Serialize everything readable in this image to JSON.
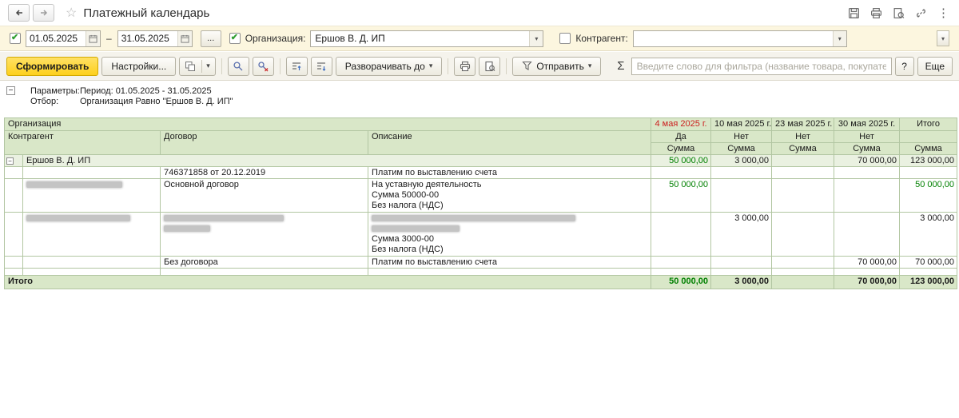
{
  "colors": {
    "accent_yellow": "#FDD01C",
    "header_green": "#D9E7C8",
    "group_green": "#EAF1E1",
    "amount_green": "#008000",
    "overdue_red": "#CC1F1F",
    "filter_bar_bg": "#FCF6DF"
  },
  "icons": {
    "back": "left-arrow",
    "forward": "right-arrow",
    "favorite": "star-outline",
    "save": "floppy",
    "print": "printer",
    "preview": "page-magnifier",
    "link": "chain",
    "menu": "kebab-dots",
    "calendar": "calendar-grid",
    "dropdown": "caret-down",
    "search": "magnifier",
    "cancel_search": "magnifier-x",
    "collapse_groups": "bars-arrow-up",
    "expand_groups": "bars-arrow-down",
    "send": "funnel",
    "variants": "layered-sheets"
  },
  "topbar": {
    "title": "Платежный календарь"
  },
  "filters": {
    "date_from": "01.05.2025",
    "range_dash": "–",
    "date_to": "31.05.2025",
    "period_more": "...",
    "org_label": "Организация:",
    "org_value": "Ершов В. Д. ИП",
    "contragent_label": "Контрагент:",
    "contragent_value": ""
  },
  "toolbar": {
    "generate": "Сформировать",
    "settings": "Настройки...",
    "expand_to": "Разворачивать до",
    "send": "Отправить",
    "sigma": "Σ",
    "filter_placeholder": "Введите слово для фильтра (название товара, покупателя и пр.)",
    "help": "?",
    "more": "Еще"
  },
  "report_header": {
    "params_label": "Параметры:",
    "params_value": "Период: 01.05.2025 - 31.05.2025",
    "filter_label": "Отбор:",
    "filter_value": "Организация Равно \"Ершов В. Д. ИП\""
  },
  "table": {
    "header": {
      "org": "Организация",
      "contragent": "Контрагент",
      "contract": "Договор",
      "description": "Описание",
      "dates": [
        "4 мая 2025 г.",
        "10 мая 2025 г.",
        "23 мая 2025 г.",
        "30 мая 2025 г."
      ],
      "flags": [
        "Да",
        "Нет",
        "Нет",
        "Нет"
      ],
      "total": "Итого",
      "sum": "Сумма"
    },
    "group": {
      "name": "Ершов В. Д. ИП",
      "d1": "50 000,00",
      "d2": "3 000,00",
      "d3": "",
      "d4": "70 000,00",
      "total": "123 000,00"
    },
    "rows": [
      {
        "contract": "746371858 от 20.12.2019",
        "desc": [
          "Платим по выставлению счета"
        ]
      },
      {
        "contract": "Основной договор",
        "desc": [
          "На уставную деятельность",
          "Сумма 50000-00",
          "Без налога (НДС)"
        ],
        "d1": "50 000,00",
        "total": "50 000,00"
      },
      {
        "desc": [
          "Сумма 3000-00",
          "Без налога (НДС)"
        ],
        "d2": "3 000,00",
        "total": "3 000,00"
      },
      {
        "contract": "Без договора",
        "desc": [
          "Платим по выставлению счета"
        ],
        "d4": "70 000,00",
        "total": "70 000,00"
      }
    ],
    "totals": {
      "label": "Итого",
      "d1": "50 000,00",
      "d2": "3 000,00",
      "d3": "",
      "d4": "70 000,00",
      "total": "123 000,00"
    }
  }
}
